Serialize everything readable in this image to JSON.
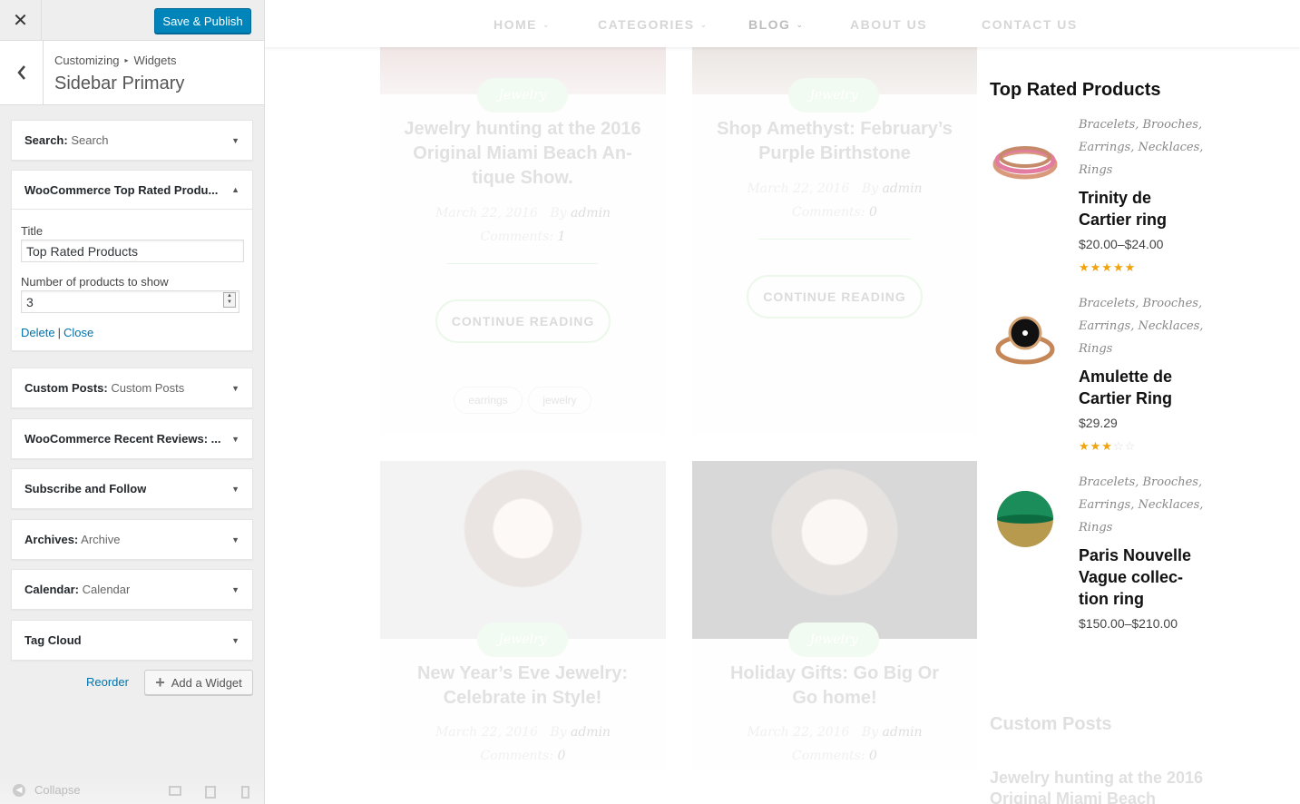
{
  "customizer": {
    "close_icon": "✕",
    "save_label": "Save & Publish",
    "back_icon": "chevron-left",
    "breadcrumb": {
      "root": "Customizing",
      "sep": "▸",
      "leaf": "Widgets"
    },
    "section_title": "Sidebar Primary",
    "widgets": [
      {
        "title": "Search:",
        "sub": "Search"
      },
      {
        "title": "WooCommerce Top Rated Produ...",
        "sub": ""
      },
      {
        "title": "Custom Posts:",
        "sub": "Custom Posts"
      },
      {
        "title": "WooCommerce Recent Reviews: ...",
        "sub": ""
      },
      {
        "title": "Subscribe and Follow",
        "sub": ""
      },
      {
        "title": "Archives:",
        "sub": "Archive"
      },
      {
        "title": "Calendar:",
        "sub": "Calendar"
      },
      {
        "title": "Tag Cloud",
        "sub": ""
      }
    ],
    "open_widget": {
      "title_label": "Title",
      "title_value": "Top Rated Products",
      "count_label": "Number of products to show",
      "count_value": "3",
      "delete_label": "Delete",
      "divider": "|",
      "close_label": "Close"
    },
    "reorder_label": "Reorder",
    "add_widget_label": "Add a Widget",
    "collapse_label": "Collapse"
  },
  "nav": {
    "items": [
      "HOME",
      "CATEGORIES",
      "BLOG",
      "ABOUT US",
      "CONTACT US"
    ],
    "chev": "⌄"
  },
  "posts": [
    {
      "category": "Jewelry",
      "title": "Jewelry hunting at the 2016 Original Miami Beach An-tique Show.",
      "date": "March 22, 2016",
      "by": "By",
      "author": "admin",
      "comments_label": "Comments:",
      "comments": "1",
      "button": "CONTINUE READING",
      "tags": [
        "earrings",
        "jewelry"
      ]
    },
    {
      "category": "Jewelry",
      "title": "Shop Amethyst: February’s Purple Birthstone",
      "date": "March 22, 2016",
      "by": "By",
      "author": "admin",
      "comments_label": "Comments:",
      "comments": "0",
      "button": "CONTINUE READING"
    },
    {
      "category": "Jewelry",
      "title": "New Year’s Eve Jewelry: Celebrate in Style!",
      "date": "March 22, 2016",
      "by": "By",
      "author": "admin",
      "comments_label": "Comments:",
      "comments": "0"
    },
    {
      "category": "Jewelry",
      "title": "Holiday Gifts: Go Big Or Go home!",
      "date": "March 22, 2016",
      "by": "By",
      "author": "admin",
      "comments_label": "Comments:",
      "comments": "0"
    }
  ],
  "top_rated": {
    "title": "Top Rated Products",
    "products": [
      {
        "cats": "Bracelets, Brooches, Earrings, Necklaces, Rings",
        "name": "Trinity de Cartier ring",
        "price": "$20.00–$24.00",
        "rating": 5
      },
      {
        "cats": "Bracelets, Brooches, Earrings, Necklaces, Rings",
        "name": "Amulette de Cartier Ring",
        "price": "$29.29",
        "rating": 3
      },
      {
        "cats": "Bracelets, Brooches, Earrings, Necklaces, Rings",
        "name": "Paris Nouvelle Vague collec-tion ring",
        "price": "$150.00–$210.00"
      }
    ]
  },
  "custom_posts": {
    "title": "Custom Posts",
    "first_item": "Jewelry hunting at the 2016 Original Miami Beach"
  },
  "colors": {
    "accent_blue": "#0085ba",
    "link_blue": "#0073aa",
    "star": "#f0a30a",
    "pill_green": "#b6e6b0"
  }
}
